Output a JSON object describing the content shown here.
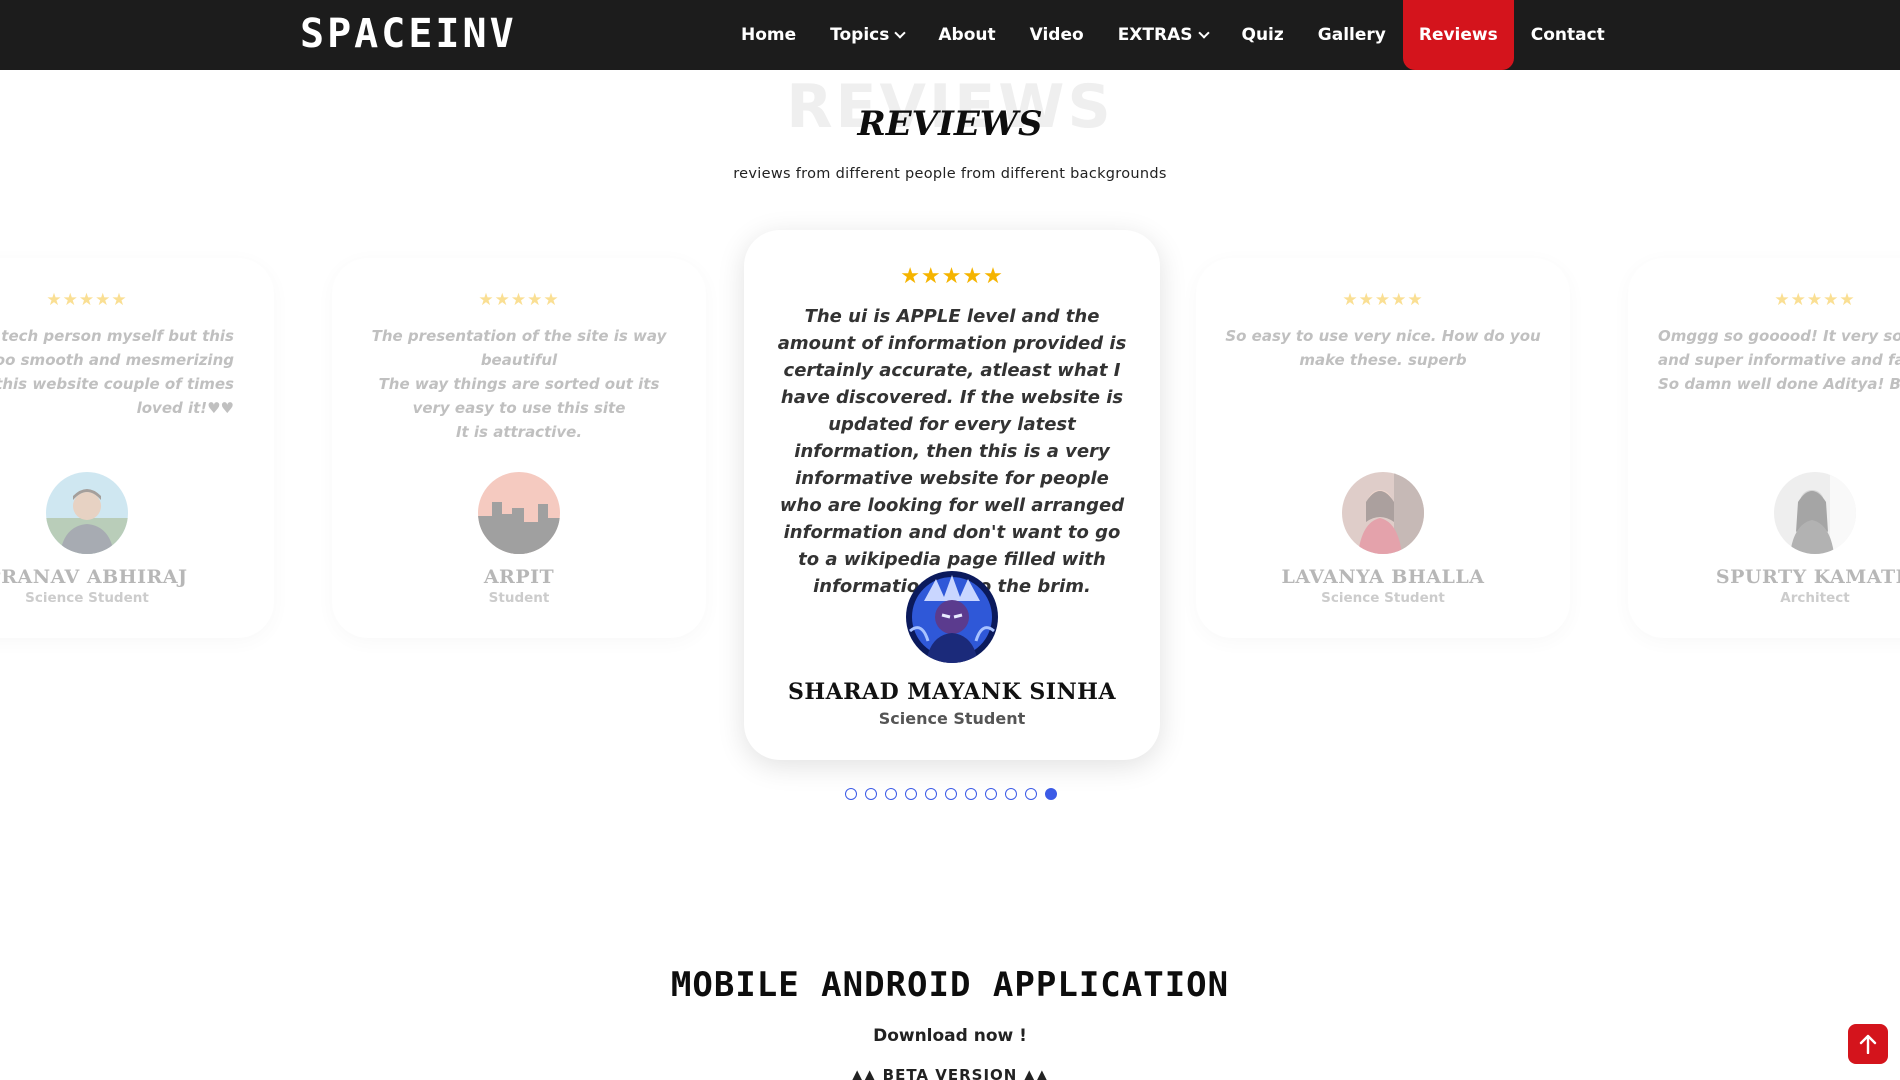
{
  "header": {
    "logo": "SPACEINV",
    "nav": [
      {
        "label": "Home"
      },
      {
        "label": "Topics"
      },
      {
        "label": "About"
      },
      {
        "label": "Video"
      },
      {
        "label": "EXTRAS"
      },
      {
        "label": "Quiz"
      },
      {
        "label": "Gallery"
      },
      {
        "label": "Reviews"
      },
      {
        "label": "Contact"
      }
    ],
    "active_nav": "Reviews"
  },
  "reviews": {
    "ghost_title": "REVIEWS",
    "title": "REVIEWS",
    "subtitle": "reviews from different people from different backgrounds",
    "stars": "★★★★★",
    "cards": [
      {
        "quote": "so a tech person myself but this\nis soo smooth and mesmerizing\nd this website couple of times\nloved it!♥♥",
        "name": "PRANAV ABHIRAJ",
        "role": "Science Student"
      },
      {
        "quote": "The presentation of the site is way beautiful\nThe way things are sorted out its very easy to use this site\nIt is attractive.",
        "name": "ARPIT",
        "role": "Student"
      },
      {
        "quote": "The ui is APPLE level and the amount of information provided is certainly accurate, atleast what I have discovered. If the website is updated for every latest information, then this is a very informative website for people who are looking for well arranged information and don't want to go to a wikipedia page filled with information up to the brim.",
        "name": "SHARAD MAYANK SINHA",
        "role": "Science Student"
      },
      {
        "quote": "So easy to use very nice. How do you make these. superb",
        "name": "LAVANYA BHALLA",
        "role": "Science Student"
      },
      {
        "quote": "Omggg so gooood! It very soothi\nand super informative and fast\nSo damn well done Aditya! Bes",
        "name": "SPURTY KAMATH",
        "role": "Architect"
      }
    ],
    "dots_total": 11,
    "dots_active_index": 10
  },
  "app_section": {
    "title": "MOBILE ANDROID APPLICATION",
    "download": "Download now !",
    "beta": "▲▲ BETA VERSION ▲▲"
  },
  "colors": {
    "header_bg": "#1c1c1c",
    "active_nav_bg": "#d4141c",
    "star": "#f5b400",
    "dot": "#3c5be6"
  },
  "icons": {
    "scroll_top": "arrow-up-icon",
    "dropdown": "chevron-down-icon"
  }
}
